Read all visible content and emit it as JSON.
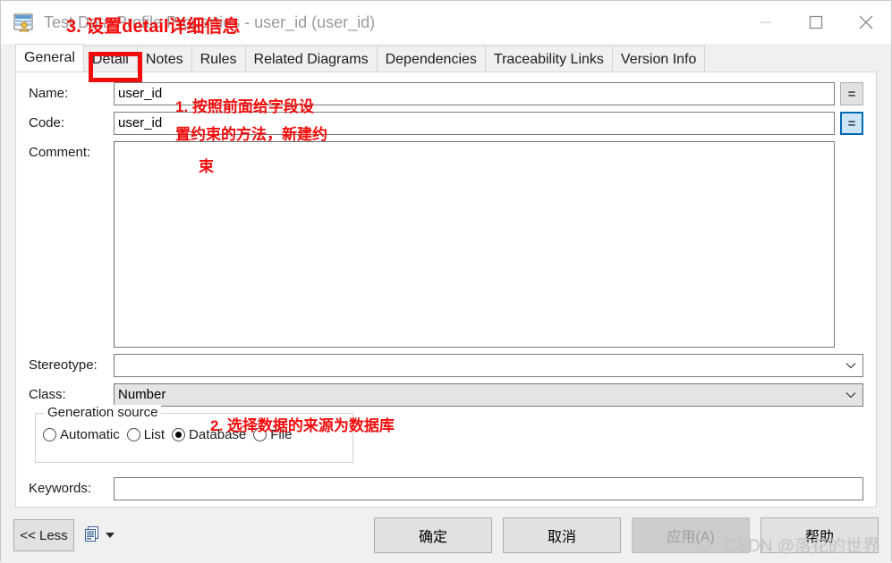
{
  "window": {
    "title": "Test Data Profile Properties - user_id (user_id)",
    "app_icon": "table-person-icon",
    "controls": {
      "minimize": "minimize-icon",
      "maximize": "maximize-icon",
      "close": "close-icon"
    }
  },
  "tabs": [
    {
      "label": "General",
      "active": true
    },
    {
      "label": "Detail",
      "active": false
    },
    {
      "label": "Notes",
      "active": false
    },
    {
      "label": "Rules",
      "active": false
    },
    {
      "label": "Related Diagrams",
      "active": false
    },
    {
      "label": "Dependencies",
      "active": false
    },
    {
      "label": "Traceability Links",
      "active": false
    },
    {
      "label": "Version Info",
      "active": false
    }
  ],
  "form": {
    "name": {
      "label": "Name:",
      "value": "user_id",
      "placeholder": ""
    },
    "code": {
      "label": "Code:",
      "value": "user_id",
      "placeholder": ""
    },
    "comment": {
      "label": "Comment:",
      "value": "",
      "placeholder": ""
    },
    "stereotype": {
      "label": "Stereotype:",
      "value": "",
      "placeholder": ""
    },
    "class": {
      "label": "Class:",
      "value": "Number",
      "placeholder": ""
    },
    "keywords": {
      "label": "Keywords:",
      "value": "",
      "placeholder": ""
    },
    "equals_button_label": "=",
    "generation_source": {
      "legend": "Generation source",
      "options": [
        {
          "label": "Automatic",
          "checked": false
        },
        {
          "label": "List",
          "checked": false
        },
        {
          "label": "Database",
          "checked": true
        },
        {
          "label": "File",
          "checked": false
        }
      ]
    }
  },
  "bottom_bar": {
    "less_label": "<< Less",
    "doc_icon": "document-list-icon",
    "dropdown_icon": "chevron-down-icon",
    "buttons": [
      {
        "label": "确定",
        "disabled": false
      },
      {
        "label": "取消",
        "disabled": false
      },
      {
        "label": "应用(A)",
        "disabled": true
      },
      {
        "label": "帮助",
        "disabled": false
      }
    ]
  },
  "annotations": {
    "step3": "3. 设置detail详细信息",
    "step1_line1": "1. 按照前面给字段设",
    "step1_line2": "置约束的方法，新建约",
    "step1_line3": "束",
    "step2": "2. 选择数据的来源为数据库"
  },
  "watermark": "CSDN @落花的世界",
  "colors": {
    "annotation_red": "#f40c0c",
    "focus_blue_border": "#0069b4",
    "focus_blue_fill": "#cce4f7",
    "window_bg": "#f0f0f0",
    "panel_white": "#ffffff",
    "disabled_grey": "#cccccc"
  }
}
